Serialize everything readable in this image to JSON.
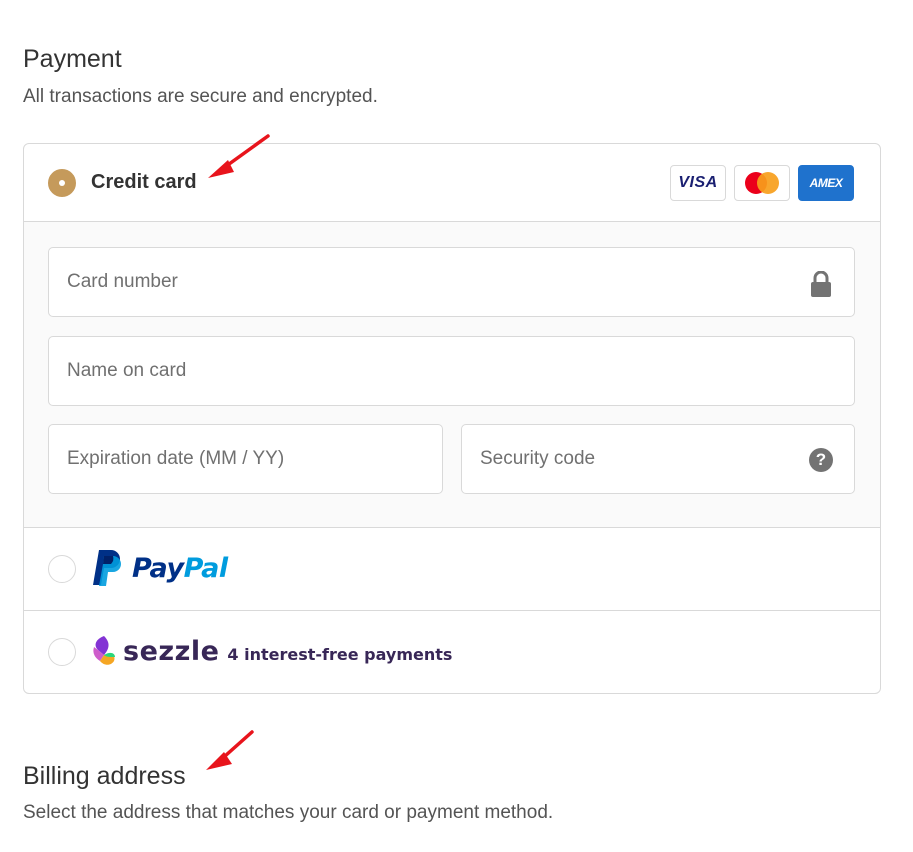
{
  "payment": {
    "title": "Payment",
    "subtitle": "All transactions are secure and encrypted."
  },
  "methods": {
    "credit_card": {
      "label": "Credit card",
      "selected": true,
      "card_brands": [
        "VISA",
        "mastercard",
        "AMEX"
      ],
      "fields": {
        "card_number": {
          "placeholder": "Card number",
          "value": ""
        },
        "name_on_card": {
          "placeholder": "Name on card",
          "value": ""
        },
        "expiration": {
          "placeholder": "Expiration date (MM / YY)",
          "value": ""
        },
        "security_code": {
          "placeholder": "Security code",
          "value": ""
        }
      }
    },
    "paypal": {
      "label_pay": "Pay",
      "label_pal": "Pal",
      "selected": false
    },
    "sezzle": {
      "label": "sezzle",
      "tagline": "4 interest-free payments",
      "selected": false
    }
  },
  "billing": {
    "title": "Billing address",
    "subtitle": "Select the address that matches your card or payment method."
  },
  "colors": {
    "accent_radio": "#c59a5b",
    "annotation_arrow": "#e8141c",
    "visa_blue": "#1a1f71",
    "amex_blue": "#1f72cd",
    "paypal_dark": "#003087",
    "paypal_light": "#009cde",
    "sezzle_purple": "#382757"
  },
  "icons": [
    "lock-icon",
    "help-icon",
    "annotation-arrow"
  ]
}
